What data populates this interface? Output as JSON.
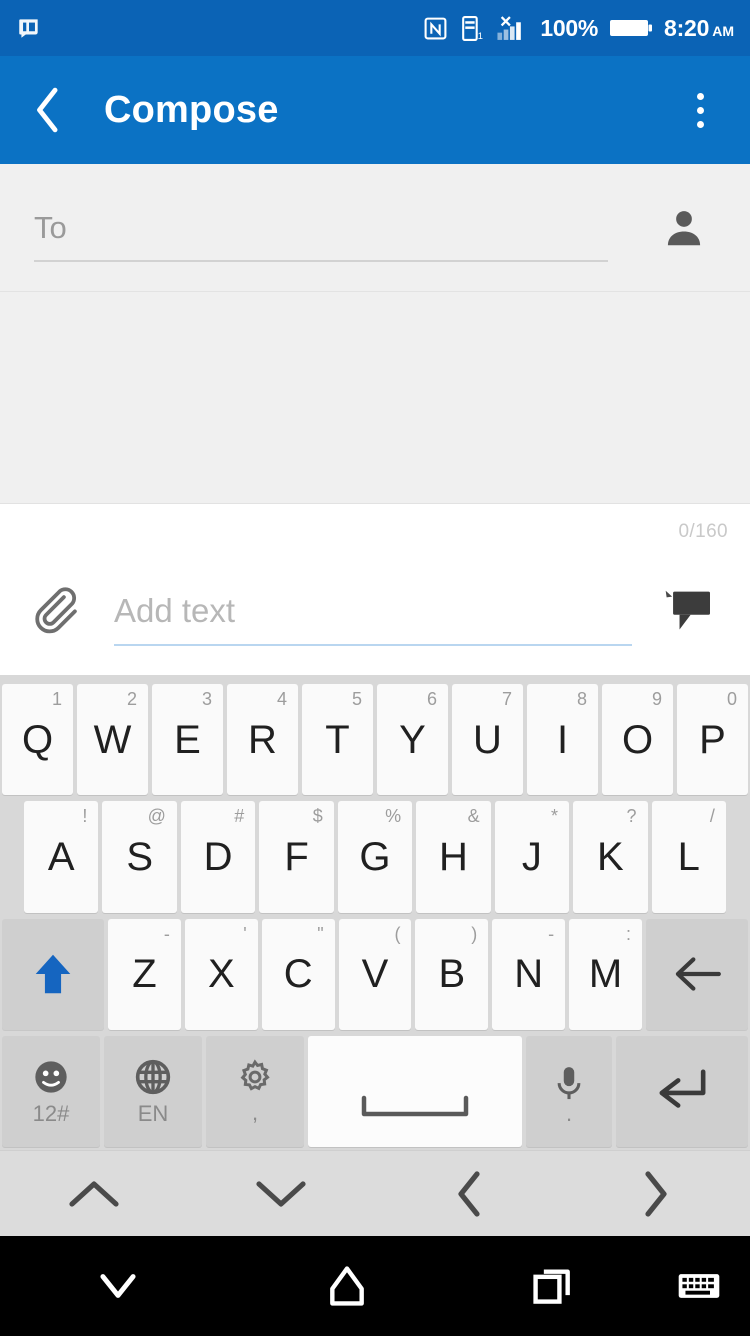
{
  "status_bar": {
    "left_icons": [
      {
        "name": "sms-notification-icon",
        "label": "SMS notification"
      }
    ],
    "right_icons": [
      {
        "name": "nfc-icon",
        "label": "NFC"
      },
      {
        "name": "vibrate-icon",
        "label": "Vibrate"
      },
      {
        "name": "signal-icon",
        "label": "Signal"
      }
    ],
    "battery_percent": "100%",
    "time": "8:20",
    "am_pm": "AM",
    "background_color": "#0b63b5",
    "foreground_color": "#ffffff"
  },
  "app_bar": {
    "title": "Compose",
    "back_icon": "chevron-left-icon",
    "overflow_icon": "more-vertical-icon",
    "background_color": "#0b72c4"
  },
  "recipient": {
    "placeholder": "To",
    "value": "",
    "contact_picker_icon": "person-icon"
  },
  "thread": {
    "messages": [],
    "background_color": "#f0f0f0"
  },
  "compose": {
    "char_counter": "0/160",
    "attach_icon": "paperclip-icon",
    "placeholder": "Add text",
    "value": "",
    "send_icon": "sms-bubble-icon",
    "underline_color": "#b9d6f0"
  },
  "keyboard": {
    "rows": [
      [
        {
          "main": "Q",
          "sup": "1"
        },
        {
          "main": "W",
          "sup": "2"
        },
        {
          "main": "E",
          "sup": "3"
        },
        {
          "main": "R",
          "sup": "4"
        },
        {
          "main": "T",
          "sup": "5"
        },
        {
          "main": "Y",
          "sup": "6"
        },
        {
          "main": "U",
          "sup": "7"
        },
        {
          "main": "I",
          "sup": "8"
        },
        {
          "main": "O",
          "sup": "9"
        },
        {
          "main": "P",
          "sup": "0"
        }
      ],
      [
        {
          "main": "A",
          "sup": "!"
        },
        {
          "main": "S",
          "sup": "@"
        },
        {
          "main": "D",
          "sup": "#"
        },
        {
          "main": "F",
          "sup": "$"
        },
        {
          "main": "G",
          "sup": "%"
        },
        {
          "main": "H",
          "sup": "&"
        },
        {
          "main": "J",
          "sup": "*"
        },
        {
          "main": "K",
          "sup": "?"
        },
        {
          "main": "L",
          "sup": "/"
        }
      ],
      [
        {
          "main": "Z",
          "sup": "-"
        },
        {
          "main": "X",
          "sup": "'"
        },
        {
          "main": "C",
          "sup": "\""
        },
        {
          "main": "V",
          "sup": "("
        },
        {
          "main": "B",
          "sup": ")"
        },
        {
          "main": "N",
          "sup": "-"
        },
        {
          "main": "M",
          "sup": ":"
        }
      ]
    ],
    "shift_icon": "shift-arrow-up-icon",
    "shift_color": "#1565c0",
    "backspace_icon": "backspace-arrow-icon",
    "bottom_row": {
      "emoji_icon": "emoji-icon",
      "emoji_label": "12#",
      "language_icon": "globe-icon",
      "language_label": "EN",
      "settings_icon": "gear-icon",
      "settings_label": ",",
      "space_icon": "spacebar-icon",
      "mic_icon": "microphone-icon",
      "mic_label": ".",
      "enter_icon": "enter-arrow-icon"
    },
    "background_color": "#d8d8d8",
    "key_color": "#fafafa"
  },
  "cursor_nav": [
    {
      "name": "nav-up",
      "icon": "chevron-up-icon"
    },
    {
      "name": "nav-down",
      "icon": "chevron-down-icon"
    },
    {
      "name": "nav-left",
      "icon": "chevron-left-icon"
    },
    {
      "name": "nav-right",
      "icon": "chevron-right-icon"
    }
  ],
  "system_nav": [
    {
      "name": "system-back",
      "icon": "chevron-down-icon"
    },
    {
      "name": "system-home",
      "icon": "home-icon"
    },
    {
      "name": "system-recents",
      "icon": "recents-icon"
    },
    {
      "name": "system-keyboard-switch",
      "icon": "keyboard-icon"
    }
  ]
}
